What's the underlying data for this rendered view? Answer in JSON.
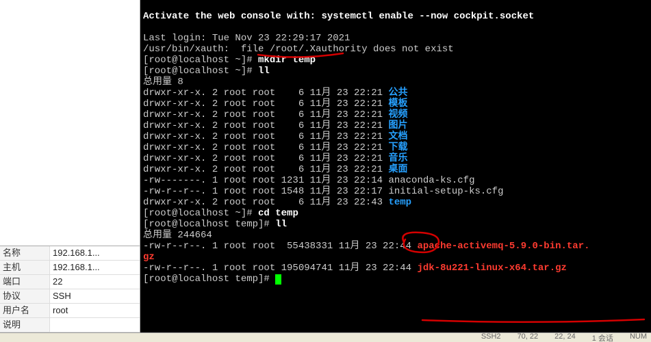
{
  "side": {
    "rows": [
      {
        "label": "名称",
        "value": "192.168.1..."
      },
      {
        "label": "主机",
        "value": "192.168.1..."
      },
      {
        "label": "端口",
        "value": "22"
      },
      {
        "label": "协议",
        "value": "SSH"
      },
      {
        "label": "用户名",
        "value": "root"
      },
      {
        "label": "说明",
        "value": ""
      }
    ]
  },
  "term": {
    "line0": "Activate the web console with: systemctl enable --now cockpit.socket",
    "lastlogin": "Last login: Tue Nov 23 22:29:17 2021",
    "xauth": "/usr/bin/xauth:  file /root/.Xauthority does not exist",
    "prompt_home": "[root@localhost ~]# ",
    "prompt_temp": "[root@localhost temp]# ",
    "cmd_mkdir": "mkdir temp",
    "cmd_ll": "ll",
    "cmd_cd": "cd temp",
    "total1": "总用量 8",
    "total2": "总用量 244664",
    "ls1_perm": "drwxr-xr-x. 2 root root    6 11月 23 22:21 ",
    "dir_public": "公共",
    "dir_template": "模板",
    "dir_video": "视频",
    "dir_pic": "图片",
    "dir_doc": "文档",
    "dir_down": "下载",
    "dir_music": "音乐",
    "dir_desk": "桌面",
    "file_anaconda": "-rw-------. 1 root root 1231 11月 23 22:14 anaconda-ks.cfg",
    "file_initial": "-rw-r--r--. 1 root root 1548 11月 23 22:17 initial-setup-ks.cfg",
    "tempdir_pre": "drwxr-xr-x. 2 root root    6 11月 23 22:43 ",
    "tempdir": "temp",
    "file_amq_pre": "-rw-r--r--. 1 root root  55438331 11月 23 22:44 ",
    "file_amq": "apache-activemq-5.9.0-bin.tar.",
    "file_amq2": "gz",
    "file_jdk_pre": "-rw-r--r--. 1 root root 195094741 11月 23 22:44 ",
    "file_jdk": "jdk-8u221-linux-x64.tar.gz"
  },
  "status": {
    "left": "",
    "ssh": "SSH2",
    "size": "70, 22",
    "pos": "22, 24",
    "sess": "1 会话",
    "num": "NUM"
  },
  "annot_colors": {
    "underline": "#d40000"
  }
}
